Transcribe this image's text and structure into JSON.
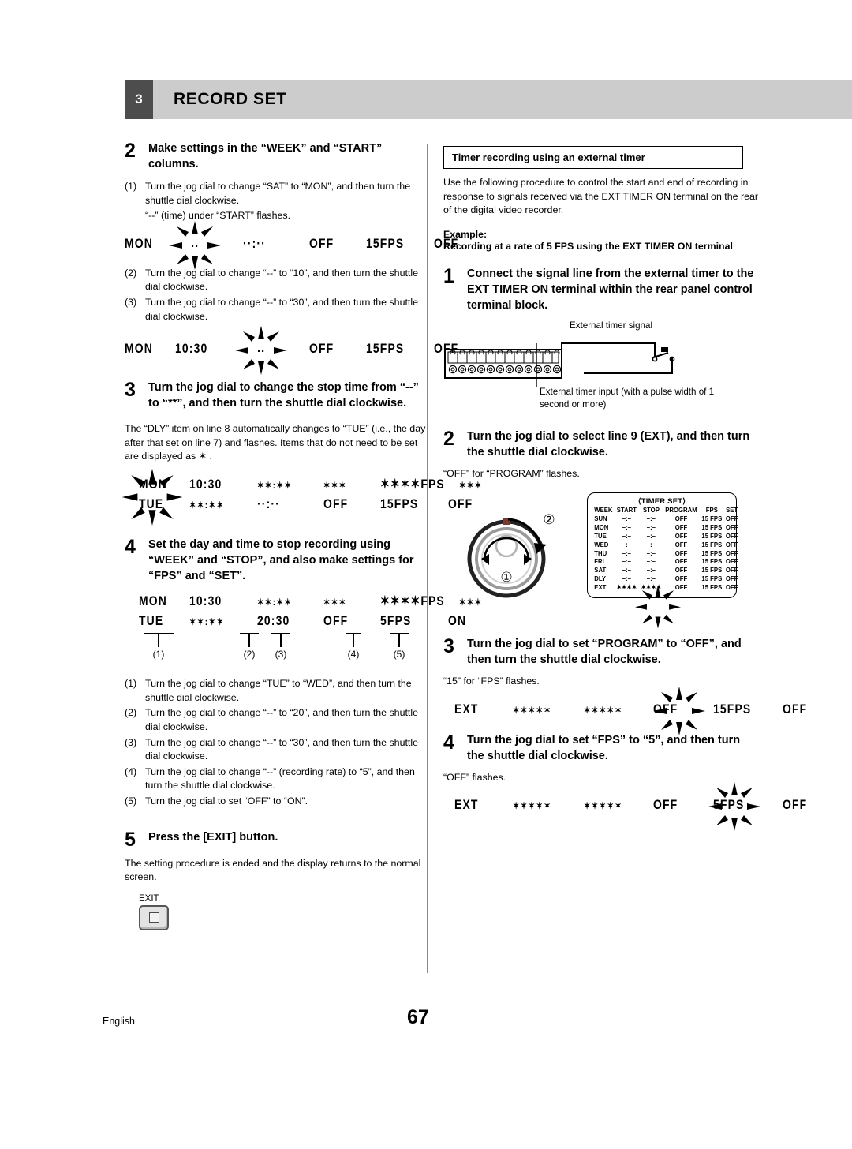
{
  "header": {
    "section_number": "3",
    "title": "RECORD SET"
  },
  "footer": {
    "language": "English",
    "page_number": "67"
  },
  "left_column": {
    "step2": {
      "number": "2",
      "title": "Make settings in the “WEEK” and “START” columns.",
      "items": [
        {
          "marker": "(1)",
          "text": "Turn the jog dial to change “SAT” to “MON”, and then turn the shuttle dial clockwise.",
          "note": "“--” (time) under “START” flashes."
        },
        {
          "marker": "(2)",
          "text": "Turn the jog dial to change “--” to “10”, and then turn the shuttle dial clockwise."
        },
        {
          "marker": "(3)",
          "text": "Turn the jog dial to change “--” to “30”, and then turn the shuttle dial clockwise."
        }
      ],
      "lcd1": {
        "week": "MON",
        "start": "",
        "stop": "··:··",
        "program": "OFF",
        "fps": "15FPS",
        "set": "OFF"
      },
      "lcd2": {
        "week": "MON",
        "start": "10:30",
        "stop": "",
        "program": "OFF",
        "fps": "15FPS",
        "set": "OFF"
      }
    },
    "step3": {
      "number": "3",
      "title": "Turn the jog dial to change the stop time from “--” to “**”, and then turn the shuttle dial clockwise.",
      "note": "The “DLY” item on line 8 automatically changes to “TUE” (i.e., the day after that set on line 7) and flashes. Items that do not need to be set are displayed as ✶ .",
      "lcd_row1": {
        "week": "MON",
        "start": "10:30",
        "stop": "✶✶:✶✶",
        "program": "✶✶✶",
        "fps": "✶✶✶✶FPS",
        "set": "✶✶✶"
      },
      "lcd_row2": {
        "week": "TUE",
        "start": "✶✶:✶✶",
        "stop": "··:··",
        "program": "OFF",
        "fps": "15FPS",
        "set": "OFF"
      }
    },
    "step4": {
      "number": "4",
      "title": "Set the day and time to stop recording using “WEEK” and “STOP”, and also make settings for “FPS” and “SET”.",
      "lcd_row1": {
        "week": "MON",
        "start": "10:30",
        "stop": "✶✶:✶✶",
        "program": "✶✶✶",
        "fps": "✶✶✶✶FPS",
        "set": "✶✶✶"
      },
      "lcd_row2": {
        "week": "TUE",
        "start": "✶✶:✶✶",
        "stop": "20:30",
        "program": "OFF",
        "fps": "5FPS",
        "set": "ON"
      },
      "callouts": [
        "(1)",
        "(2)",
        "(3)",
        "(4)",
        "(5)"
      ],
      "items": [
        {
          "marker": "(1)",
          "text": "Turn the jog dial to change “TUE” to “WED”, and then turn the shuttle dial clockwise."
        },
        {
          "marker": "(2)",
          "text": "Turn the jog dial to change “--” to “20”, and then turn the shuttle dial clockwise."
        },
        {
          "marker": "(3)",
          "text": "Turn the jog dial to change “--” to “30”, and then turn the shuttle dial clockwise."
        },
        {
          "marker": "(4)",
          "text": "Turn the jog dial to change “--” (recording rate) to “5”, and then turn the shuttle dial clockwise."
        },
        {
          "marker": "(5)",
          "text": "Turn the jog dial to set “OFF” to “ON”."
        }
      ]
    },
    "step5": {
      "number": "5",
      "title": "Press the [EXIT] button.",
      "note": "The setting procedure is ended and the display returns to the normal screen.",
      "exit_button_label": "EXIT"
    }
  },
  "right_column": {
    "boxed_heading": "Timer recording using an external timer",
    "intro": "Use the following procedure to control the start and end of recording in response to signals received via the EXT TIMER ON terminal on the rear of the digital video recorder.",
    "example_label": "Example:",
    "example_text": "Recording at a rate of 5 FPS using the EXT TIMER ON terminal",
    "step1": {
      "number": "1",
      "title": "Connect the signal line from the external timer to the EXT TIMER ON terminal within the rear panel control terminal block.",
      "diagram": {
        "label_top": "External timer signal",
        "label_bottom": "External timer input (with a pulse width of 1 second or more)",
        "terminal_count": 12
      }
    },
    "step2": {
      "number": "2",
      "title": "Turn the jog dial to select line 9 (EXT), and then turn the shuttle dial clockwise.",
      "note": "“OFF” for “PROGRAM” flashes.",
      "dial_markers": [
        "①",
        "②"
      ]
    },
    "step3": {
      "number": "3",
      "title": "Turn the jog dial to set “PROGRAM” to “OFF”, and then turn the shuttle dial clockwise.",
      "note": "“15” for “FPS” flashes.",
      "lcd": {
        "week": "EXT",
        "start": "✶✶✶✶✶",
        "stop": "✶✶✶✶✶",
        "program": "OFF",
        "fps": "15FPS",
        "set": "OFF"
      }
    },
    "step4": {
      "number": "4",
      "title": "Turn the jog dial to set “FPS” to “5”, and then turn the shuttle dial clockwise.",
      "note": "“OFF” flashes.",
      "lcd": {
        "week": "EXT",
        "start": "✶✶✶✶✶",
        "stop": "✶✶✶✶✶",
        "program": "OFF",
        "fps": "5FPS",
        "set": "OFF"
      }
    },
    "timer_set_table": {
      "title": "⟨TIMER SET⟩",
      "columns": [
        "WEEK",
        "START",
        "STOP",
        "PROGRAM",
        "FPS",
        "SET"
      ],
      "rows": [
        {
          "week": "SUN",
          "start": "–:–",
          "stop": "–:–",
          "program": "OFF",
          "fps": "15 FPS",
          "set": "OFF"
        },
        {
          "week": "MON",
          "start": "–:–",
          "stop": "–:–",
          "program": "OFF",
          "fps": "15 FPS",
          "set": "OFF"
        },
        {
          "week": "TUE",
          "start": "–:–",
          "stop": "–:–",
          "program": "OFF",
          "fps": "15 FPS",
          "set": "OFF"
        },
        {
          "week": "WED",
          "start": "–:–",
          "stop": "–:–",
          "program": "OFF",
          "fps": "15 FPS",
          "set": "OFF"
        },
        {
          "week": "THU",
          "start": "–:–",
          "stop": "–:–",
          "program": "OFF",
          "fps": "15 FPS",
          "set": "OFF"
        },
        {
          "week": "FRI",
          "start": "–:–",
          "stop": "–:–",
          "program": "OFF",
          "fps": "15 FPS",
          "set": "OFF"
        },
        {
          "week": "SAT",
          "start": "–:–",
          "stop": "–:–",
          "program": "OFF",
          "fps": "15 FPS",
          "set": "OFF"
        },
        {
          "week": "DLY",
          "start": "–:–",
          "stop": "–:–",
          "program": "OFF",
          "fps": "15 FPS",
          "set": "OFF"
        },
        {
          "week": "EXT",
          "start": "✶✶✶✶",
          "stop": "✶✶✶✶",
          "program": "OFF",
          "fps": "15 FPS",
          "set": "OFF"
        }
      ]
    }
  },
  "colors": {
    "header_number_bg": "#4d4d4d",
    "header_title_bg": "#cccccc",
    "text": "#000000",
    "divider": "#8a8a8a"
  }
}
